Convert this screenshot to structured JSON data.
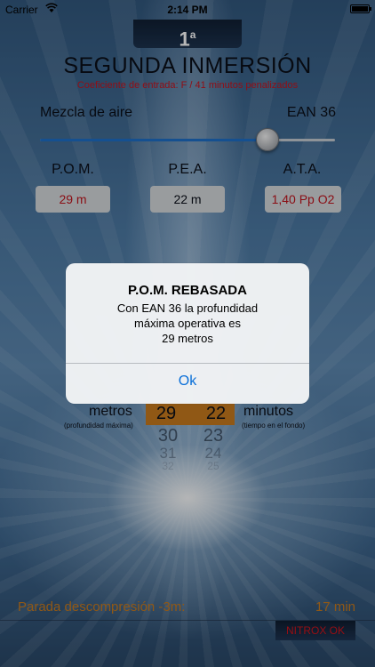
{
  "status_bar": {
    "carrier": "Carrier",
    "time": "2:14 PM"
  },
  "header": {
    "dive_index": "1",
    "dive_index_sup": "a",
    "title": "SEGUNDA INMERSIÓN",
    "subtitle": "Coeficiente de entrada: F / 41 minutos penalizados"
  },
  "mix": {
    "label": "Mezcla de aire",
    "value": "EAN 36",
    "slider_level": 0.77
  },
  "columns": [
    {
      "label": "P.O.M.",
      "value": "29 m"
    },
    {
      "label": "P.E.A.",
      "value": "22 m"
    },
    {
      "label": "A.T.A.",
      "value": "1,40 Pp O2"
    }
  ],
  "picker": {
    "left_label": "metros",
    "left_sublabel": "(profundidad máxima)",
    "right_label": "minutos",
    "right_sublabel": "(tiempo en el fondo)",
    "depth_selected": "29",
    "depth_next": [
      "30",
      "31",
      "32"
    ],
    "time_selected": "22",
    "time_next": [
      "23",
      "24",
      "25"
    ]
  },
  "bottom": {
    "deco_label": "Parada descompresión  -3m:",
    "deco_value": "17 min",
    "nitrox_button": "NITROX OK"
  },
  "alert": {
    "title": "P.O.M. REBASADA",
    "message_lines": [
      "Con EAN 36 la profundidad",
      "máxima operativa es",
      "29 metros"
    ],
    "ok_label": "Ok"
  },
  "colors": {
    "accent_red": "#c0141c",
    "accent_orange": "#c87a1e",
    "ios_blue": "#0a6fd8"
  }
}
